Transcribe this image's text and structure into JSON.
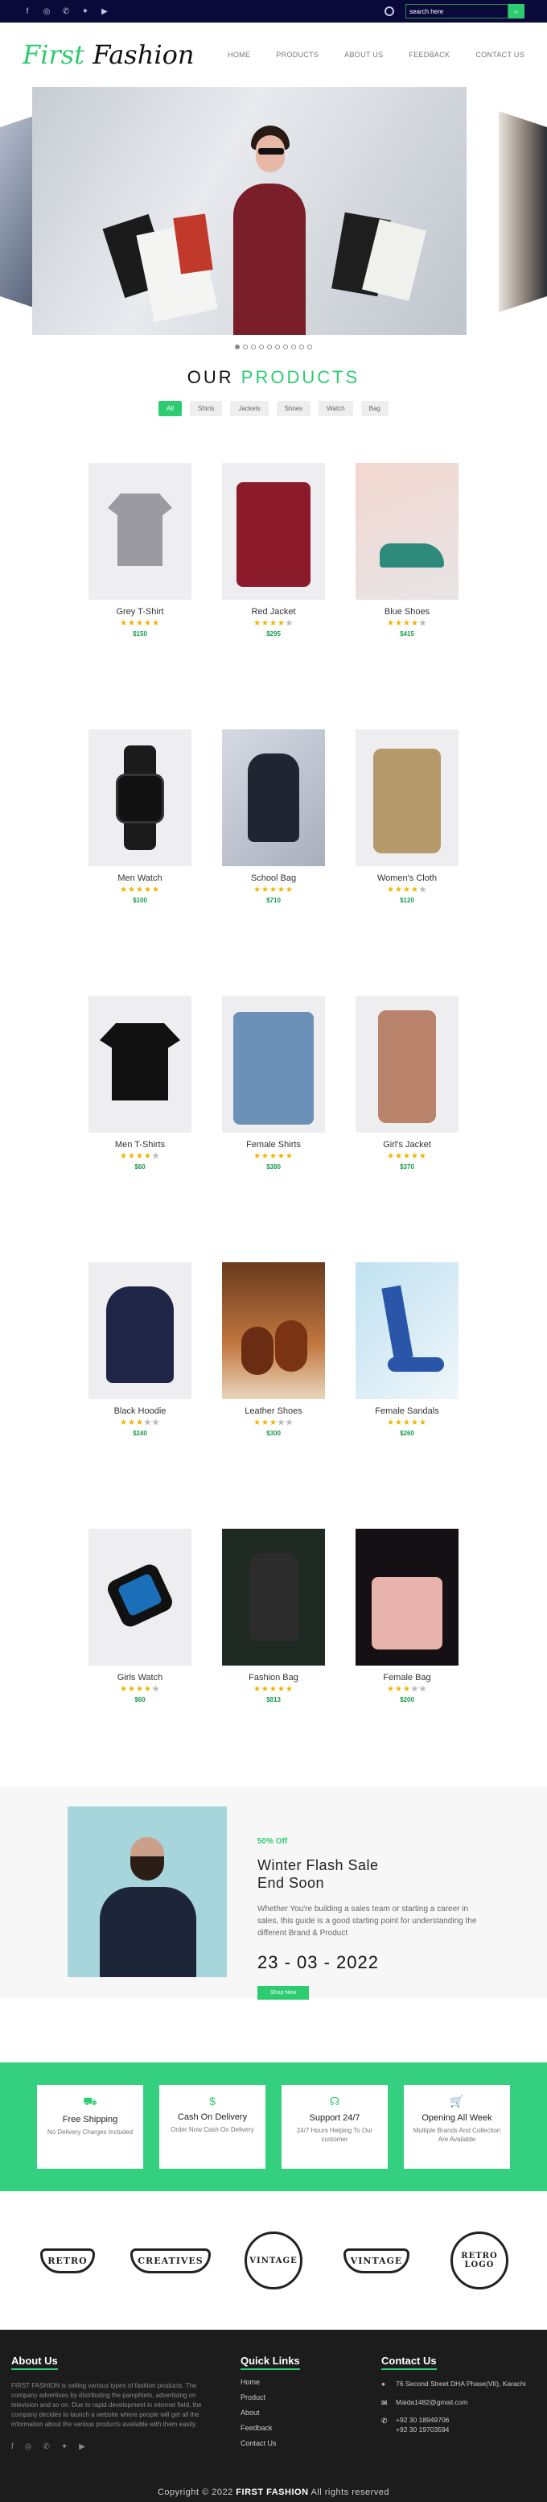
{
  "topbar": {
    "social_icons": [
      "facebook-icon",
      "instagram-icon",
      "whatsapp-icon",
      "twitter-icon",
      "youtube-icon"
    ],
    "search_placeholder": "search here"
  },
  "nav": {
    "logo_part1": "First",
    "logo_part2": "Fashion",
    "links": [
      "HOME",
      "PRODUCTS",
      "ABOUT US",
      "FEEDBACK",
      "CONTACT US"
    ]
  },
  "slider": {
    "dot_count": 10,
    "active_index": 0
  },
  "products_section": {
    "title_part1": "OUR",
    "title_part2": "PRODUCTS",
    "filters": [
      "All",
      "Shirts",
      "Jackets",
      "Shoes",
      "Watch",
      "Bag"
    ],
    "active_filter": "All"
  },
  "products": [
    {
      "name": "Grey T-Shirt",
      "rating": 5,
      "price": "$150"
    },
    {
      "name": "Red Jacket",
      "rating": 4,
      "price": "$295"
    },
    {
      "name": "Blue Shoes",
      "rating": 4,
      "price": "$415"
    },
    {
      "name": "Men Watch",
      "rating": 5,
      "price": "$100"
    },
    {
      "name": "School Bag",
      "rating": 5,
      "price": "$710"
    },
    {
      "name": "Women's Cloth",
      "rating": 4,
      "price": "$120"
    },
    {
      "name": "Men T-Shirts",
      "rating": 4,
      "price": "$60"
    },
    {
      "name": "Female Shirts",
      "rating": 5,
      "price": "$380"
    },
    {
      "name": "Girl's Jacket",
      "rating": 5,
      "price": "$370"
    },
    {
      "name": "Black Hoodie",
      "rating": 3,
      "price": "$240"
    },
    {
      "name": "Leather Shoes",
      "rating": 3,
      "price": "$300"
    },
    {
      "name": "Female Sandals",
      "rating": 5,
      "price": "$260"
    },
    {
      "name": "Girls Watch",
      "rating": 4,
      "price": "$60"
    },
    {
      "name": "Fashion Bag",
      "rating": 5,
      "price": "$813"
    },
    {
      "name": "Female Bag",
      "rating": 3,
      "price": "$200"
    }
  ],
  "promo": {
    "discount": "50% Off",
    "title_line1": "Winter Flash Sale",
    "title_line2": "End Soon",
    "description": "Whether You're building a sales team or starting a career in sales, this guide is a good starting point for understanding the different Brand & Product",
    "date": "23 - 03 - 2022",
    "button": "Shop Now"
  },
  "services": [
    {
      "icon": "truck-icon",
      "title": "Free Shipping",
      "desc": "No Delivery Charges Included"
    },
    {
      "icon": "dollar-icon",
      "title": "Cash On Delivery",
      "desc": "Order Now Cash On Delivery"
    },
    {
      "icon": "headset-icon",
      "title": "Support 24/7",
      "desc": "24/7 Hours Helping To Our customer"
    },
    {
      "icon": "cart-icon",
      "title": "Opening All Week",
      "desc": "Multiple Brands And Collection Are Available"
    }
  ],
  "brands": [
    "RETRO",
    "CREATIVES",
    "VINTAGE",
    "VINTAGE",
    "RETRO LOGO"
  ],
  "footer": {
    "about_title": "About Us",
    "about_text": "FIRST FASHION is selling various types of fashion products. The company advertises by distributing the pamphlets, advertising on television and so on. Due to rapid development in internet field, the company decides to launch a website where people will get all the information about the various products available with them easily.",
    "links_title": "Quick Links",
    "links": [
      "Home",
      "Product",
      "About",
      "Feedback",
      "Contact Us"
    ],
    "contact_title": "Contact Us",
    "address": "76 Second Street DHA Phase(VII), Karachi",
    "email": "Maida1482@gmail.com",
    "phone1": "+92 30 18949706",
    "phone2": "+92 30 19703594",
    "copyright_prefix": "Copyright © 2022",
    "copyright_brand": "FIRST FASHION",
    "copyright_suffix": "All rights reserved"
  }
}
